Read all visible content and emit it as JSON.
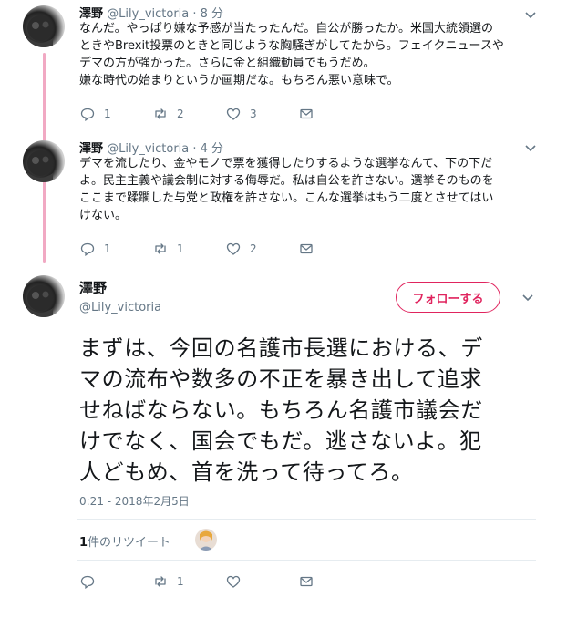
{
  "reply1": {
    "name": "澤野",
    "handle": "@Lily_victoria",
    "time": "· 8 分",
    "lines": [
      "なんだ。やっぱり嫌な予感が当たったんだ。自公が勝ったか。米国大統領選の",
      "ときやBrexit投票のときと同じような胸騒ぎがしてたから。フェイクニュースや",
      "デマの方が強かった。さらに金と組織動員でもうだめ。",
      "嫌な時代の始まりというか画期だな。もちろん悪い意味で。"
    ],
    "reply_count": "1",
    "retweet_count": "2",
    "like_count": "3"
  },
  "reply2": {
    "name": "澤野",
    "handle": "@Lily_victoria",
    "time": "· 4 分",
    "lines": [
      "デマを流したり、金やモノで票を獲得したりするような選挙なんて、下の下だ",
      "よ。民主主義や議会制に対する侮辱だ。私は自公を許さない。選挙そのものを",
      "ここまで蹂躙した与党と政権を許さない。こんな選挙はもう二度とさせてはい",
      "けない。"
    ],
    "reply_count": "1",
    "retweet_count": "1",
    "like_count": "2"
  },
  "main": {
    "name": "澤野",
    "handle": "@Lily_victoria",
    "follow_label": "フォローする",
    "lines": [
      "まずは、今回の名護市長選における、デ",
      "マの流布や数多の不正を暴き出して追求",
      "せねばならない。もちろん名護市議会だ",
      "けでなく、国会でもだ。逃さないよ。犯",
      "人どもめ、首を洗って待ってろ。"
    ],
    "timestamp": "0:21 - 2018年2月5日",
    "retweets_count": "1",
    "retweets_label": "件のリツイート",
    "reply_count": "",
    "retweet_count": "1",
    "like_count": ""
  },
  "colors": {
    "accent": "#e0245e",
    "thread_line": "#f1a9c3",
    "muted": "#657786",
    "divider": "#e6ecf0"
  },
  "icons": [
    "reply-icon",
    "retweet-icon",
    "like-icon",
    "dm-icon",
    "chevron-down-icon"
  ]
}
